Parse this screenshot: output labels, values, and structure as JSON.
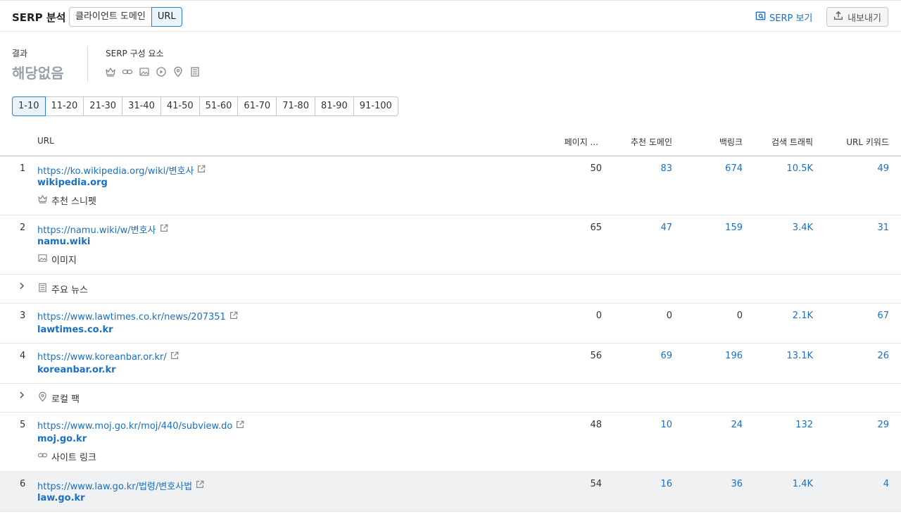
{
  "header": {
    "title": "SERP 분석",
    "seg_client_domain": "클라이언트 도메인",
    "seg_url": "URL",
    "serp_view": "SERP 보기",
    "export": "내보내기"
  },
  "summary": {
    "results_label": "결과",
    "results_value": "해당없음",
    "features_label": "SERP 구성 요소",
    "feature_icons": [
      "crown-icon",
      "link-icon",
      "image-icon",
      "video-icon",
      "location-pin-icon",
      "news-icon"
    ]
  },
  "pagination": [
    "1-10",
    "11-20",
    "21-30",
    "31-40",
    "41-50",
    "51-60",
    "61-70",
    "71-80",
    "81-90",
    "91-100"
  ],
  "pagination_active": "1-10",
  "table": {
    "headers": {
      "url": "URL",
      "page": "페이지 ...",
      "ref_domains": "추천 도메인",
      "backlinks": "백링크",
      "traffic": "검색 트래픽",
      "url_keywords": "URL 키워드"
    },
    "rows": [
      {
        "n": "1",
        "url": "https://ko.wikipedia.org/wiki/변호사",
        "domain": "wikipedia.org",
        "feature": "추천 스니펫",
        "feature_icon": "crown-icon",
        "page": "50",
        "ref_domains": "83",
        "backlinks": "674",
        "traffic": "10.5K",
        "keywords": "49"
      },
      {
        "n": "2",
        "url": "https://namu.wiki/w/변호사",
        "domain": "namu.wiki",
        "feature": "이미지",
        "feature_icon": "image-icon",
        "page": "65",
        "ref_domains": "47",
        "backlinks": "159",
        "traffic": "3.4K",
        "keywords": "31"
      },
      {
        "group": "주요 뉴스",
        "group_icon": "news-icon"
      },
      {
        "n": "3",
        "url": "https://www.lawtimes.co.kr/news/207351",
        "domain": "lawtimes.co.kr",
        "page": "0",
        "ref_domains": "0",
        "backlinks": "0",
        "traffic": "2.1K",
        "keywords": "67"
      },
      {
        "n": "4",
        "url": "https://www.koreanbar.or.kr/",
        "domain": "koreanbar.or.kr",
        "page": "56",
        "ref_domains": "69",
        "backlinks": "196",
        "traffic": "13.1K",
        "keywords": "26"
      },
      {
        "group": "로컬 팩",
        "group_icon": "location-pin-icon"
      },
      {
        "n": "5",
        "url": "https://www.moj.go.kr/moj/440/subview.do",
        "domain": "moj.go.kr",
        "feature": "사이트 링크",
        "feature_icon": "link-icon",
        "page": "48",
        "ref_domains": "10",
        "backlinks": "24",
        "traffic": "132",
        "keywords": "29"
      },
      {
        "n": "6",
        "url": "https://www.law.go.kr/법령/변호사법",
        "domain": "law.go.kr",
        "page": "54",
        "ref_domains": "16",
        "backlinks": "36",
        "traffic": "1.4K",
        "keywords": "4"
      }
    ]
  },
  "colors": {
    "link": "#1b6fc4",
    "active_border": "#2f7dcf",
    "active_bg": "#eaf3fc",
    "muted": "#9aa0a8",
    "highlight_row": "#f0f1f3"
  }
}
